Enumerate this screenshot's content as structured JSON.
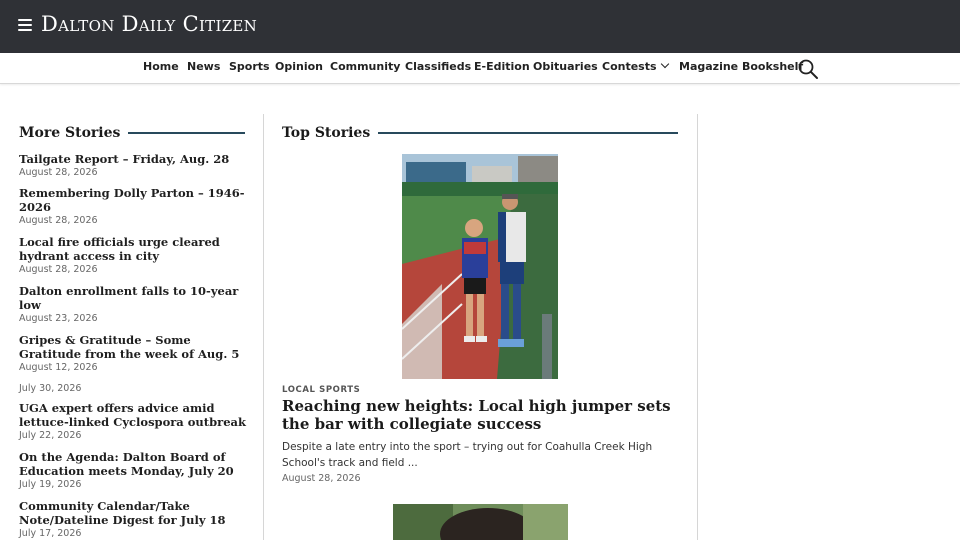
{
  "header": {
    "masthead": "Dalton Daily Citizen"
  },
  "nav": {
    "items": [
      "Home",
      "News",
      "Sports",
      "Opinion",
      "Community",
      "Classifieds",
      "E-Edition",
      "Obituaries",
      "Contests",
      "Magazine Bookshelf"
    ]
  },
  "more_stories": {
    "title": "More Stories",
    "items": [
      {
        "headline": "Tailgate Report – Friday, Aug. 28",
        "date": "August 28, 2026"
      },
      {
        "headline": "Remembering Dolly Parton – 1946-2026",
        "date": "August 28, 2026"
      },
      {
        "headline": "Local fire officials urge cleared hydrant access in city",
        "date": "August 28, 2026"
      },
      {
        "headline": "Dalton enrollment falls to 10-year low",
        "date": "August 23, 2026"
      },
      {
        "headline": "Gripes & Gratitude – Some Gratitude from the week of Aug. 5",
        "date": "August 12, 2026"
      },
      {
        "headline": "",
        "date": "July 30, 2026"
      },
      {
        "headline": "UGA expert offers advice amid lettuce-linked Cyclospora outbreak",
        "date": "July 22, 2026"
      },
      {
        "headline": "On the Agenda: Dalton Board of Education meets Monday, July 20",
        "date": "July 19, 2026"
      },
      {
        "headline": "Community Calendar/Take Note/Dateline Digest for July 18",
        "date": "July 17, 2026"
      }
    ]
  },
  "top_stories": {
    "title": "Top Stories",
    "lead": {
      "kicker": "LOCAL SPORTS",
      "headline": "Reaching new heights: Local high jumper sets the bar with collegiate success",
      "teaser": "Despite a late entry into the sport – trying out for Coahulla Creek High School's track and field ...",
      "date": "August 28, 2026"
    }
  },
  "colors": {
    "header_bg": "#2f3136",
    "section_rule": "#284a5c"
  },
  "icons": [
    "menu-icon",
    "search-icon",
    "chevron-down-icon"
  ]
}
